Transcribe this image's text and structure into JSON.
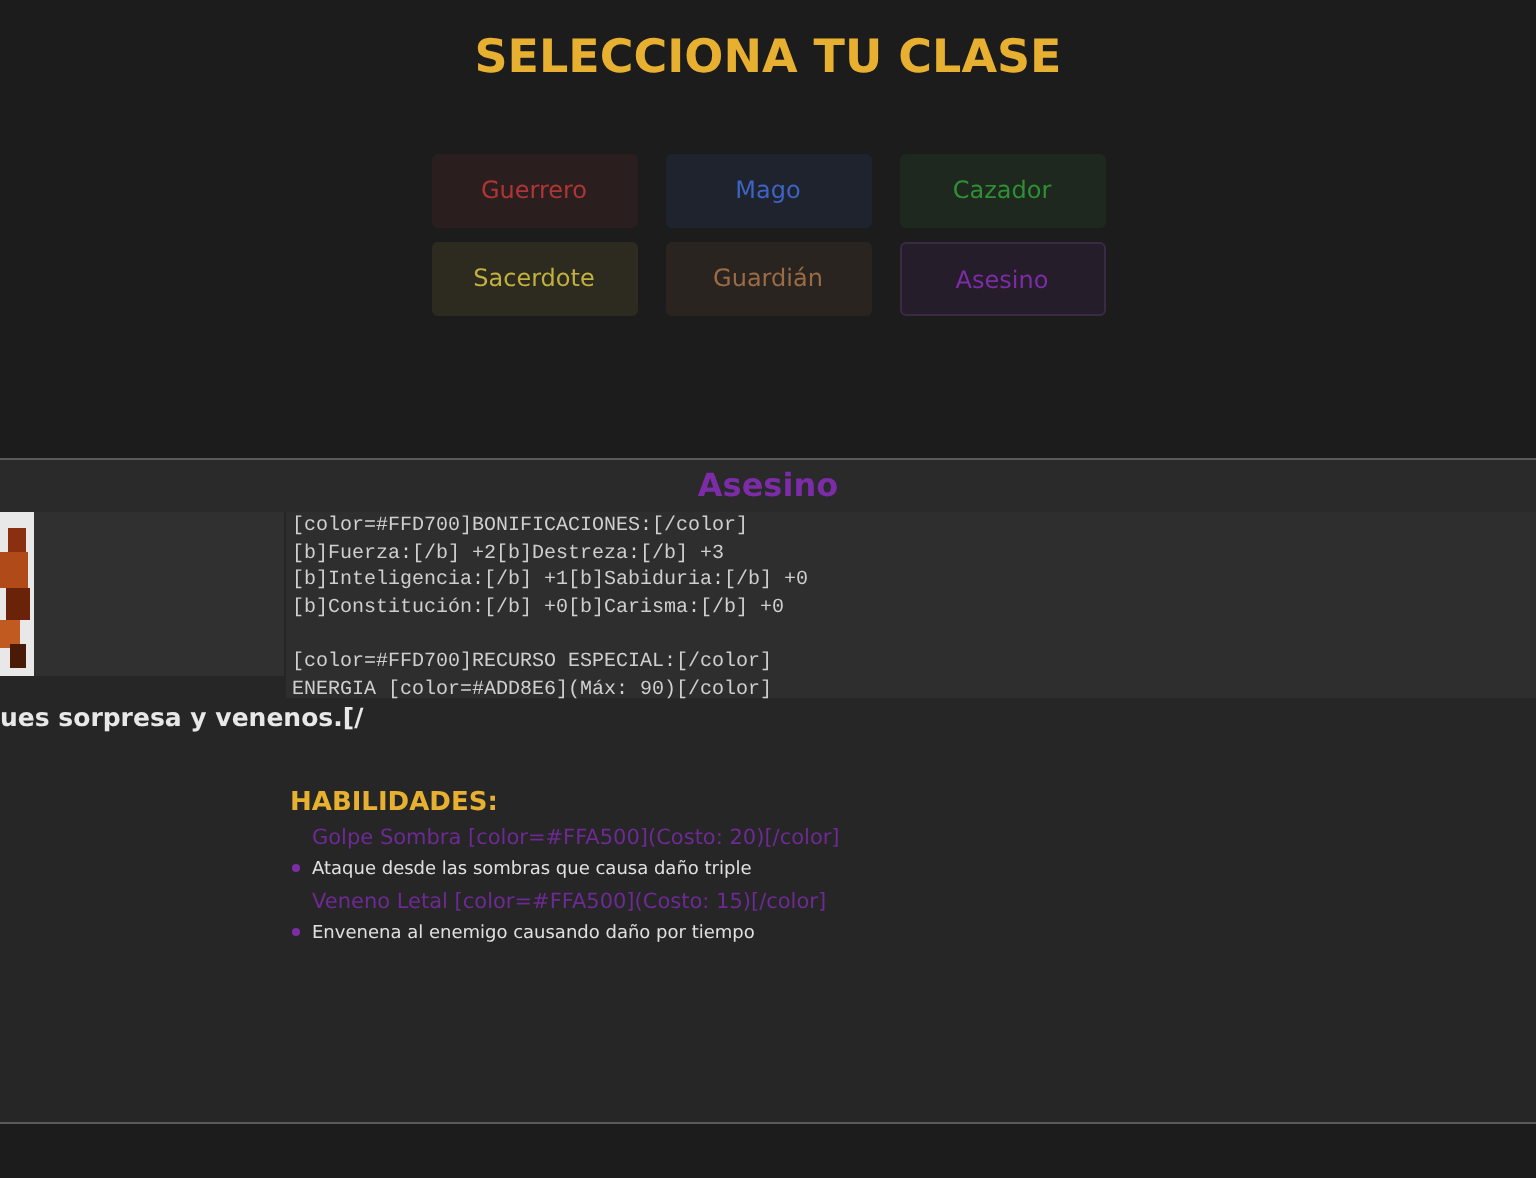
{
  "title": "SELECCIONA TU CLASE",
  "classes": [
    {
      "label": "Guerrero",
      "color": "#b03535",
      "selected": false
    },
    {
      "label": "Mago",
      "color": "#3d63c4",
      "selected": false
    },
    {
      "label": "Cazador",
      "color": "#2f8f35",
      "selected": false
    },
    {
      "label": "Sacerdote",
      "color": "#c2b03f",
      "selected": false
    },
    {
      "label": "Guardián",
      "color": "#9a6b45",
      "selected": false
    },
    {
      "label": "Asesino",
      "color": "#7d2ca8",
      "selected": true
    }
  ],
  "detail": {
    "name": "Asesino",
    "stats_blocks": [
      [
        "[color=#FFD700]BONIFICACIONES:[/color]",
        "[b]Fuerza:[/b] +2[b]Destreza:[/b] +3",
        "[b]Inteligencia:[/b] +1[b]Sabiduria:[/b] +0",
        "[b]Constitución:[/b] +0[b]Carisma:[/b] +0"
      ],
      [
        "[color=#FFD700]RECURSO ESPECIAL:[/color]",
        "ENERGIA [color=#ADD8E6](Máx: 90)[/color]"
      ]
    ],
    "description": "ues sorpresa y venenos.[/",
    "abilities_heading": "HABILIDADES:",
    "abilities": [
      {
        "name": "Golpe Sombra [color=#FFA500](Costo: 20)[/color]",
        "text": "Ataque desde las sombras que causa daño triple"
      },
      {
        "name": "Veneno Letal [color=#FFA500](Costo: 15)[/color]",
        "text": "Envenena al enemigo causando daño por tiempo"
      }
    ]
  }
}
